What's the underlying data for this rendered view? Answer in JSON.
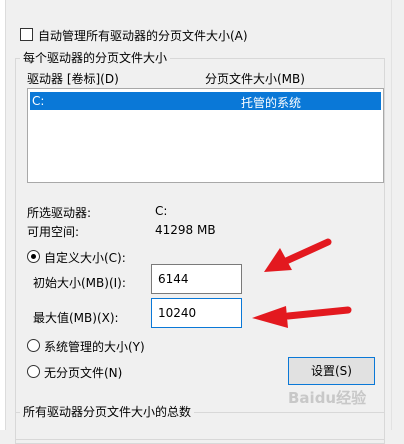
{
  "auto_manage": {
    "label": "自动管理所有驱动器的分页文件大小(A)",
    "checked": false
  },
  "per_drive_group": {
    "title": "每个驱动器的分页文件大小",
    "columns": [
      "驱动器 [卷标](D)",
      "分页文件大小(MB)"
    ],
    "rows": [
      {
        "drive": "C:",
        "size": "托管的系统",
        "selected": true
      }
    ]
  },
  "selected_drive": {
    "label": "所选驱动器:",
    "value": "C:"
  },
  "free_space": {
    "label": "可用空间:",
    "value": "41298 MB"
  },
  "custom_size": {
    "label": "自定义大小(C):",
    "selected": true,
    "initial_label": "初始大小(MB)(I):",
    "initial_value": "6144",
    "max_label": "最大值(MB)(X):",
    "max_value": "10240"
  },
  "system_managed": {
    "label": "系统管理的大小(Y)",
    "selected": false
  },
  "no_paging": {
    "label": "无分页文件(N)",
    "selected": false
  },
  "set_button": {
    "label": "设置(S)"
  },
  "total_group": {
    "title": "所有驱动器分页文件大小的总数"
  },
  "watermark": {
    "text": "Baidu经验"
  },
  "colors": {
    "accent": "#0a78d7",
    "arrow": "#e3191f"
  }
}
